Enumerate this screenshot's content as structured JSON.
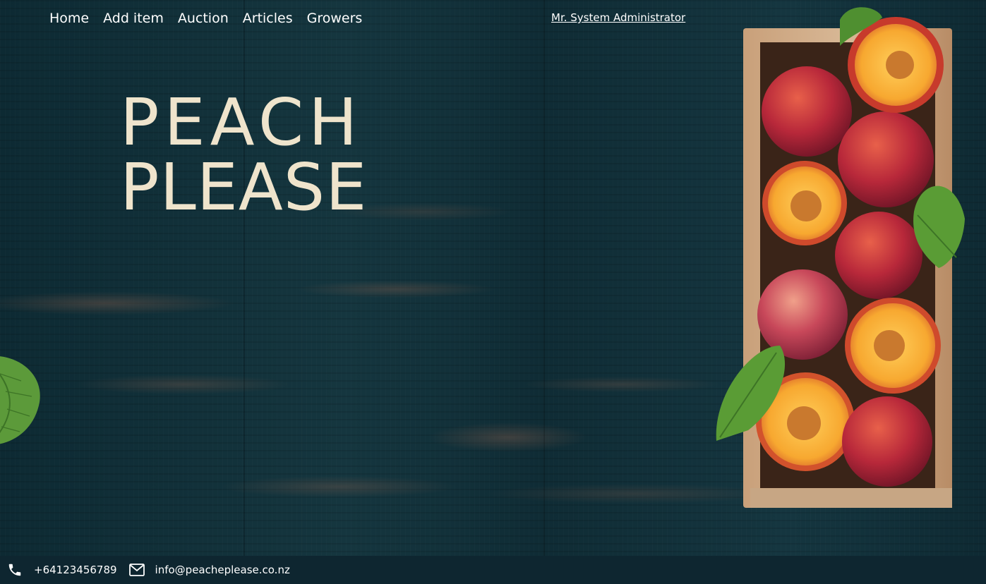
{
  "nav": {
    "items": [
      {
        "label": "Home"
      },
      {
        "label": "Add item"
      },
      {
        "label": "Auction"
      },
      {
        "label": "Articles"
      },
      {
        "label": "Growers"
      }
    ],
    "user_link": "Mr. System Administrator"
  },
  "hero": {
    "title_line1": "PEACH",
    "title_line2": "PLEASE"
  },
  "footer": {
    "phone": "+64123456789",
    "email": "info@peacheplease.co.nz",
    "phone_icon": "phone-icon",
    "email_icon": "mail-icon"
  },
  "colors": {
    "background": "#12303a",
    "title": "#efe4cc",
    "footer": "#0e2630",
    "nav_text": "#ffffff"
  }
}
